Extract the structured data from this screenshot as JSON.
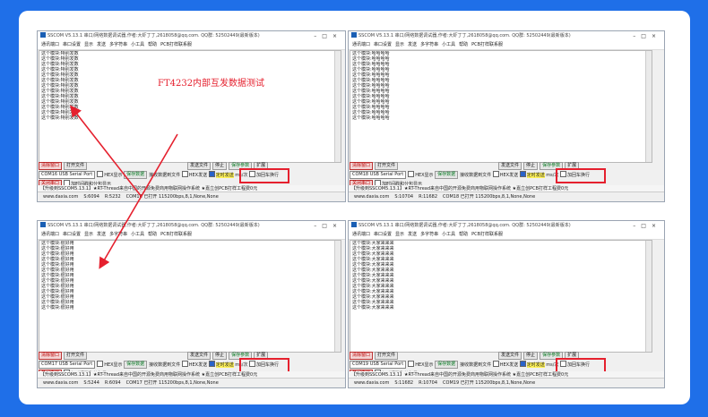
{
  "annotation": "FT4232内部互发数据测试",
  "windows": [
    {
      "id": "tl",
      "title": "SSCOM V5.13.1 串口/网络数据调试器,作者:大虾丁丁,2618058@qq.com. QQ群: 52502449(最新版本)",
      "menu": [
        "通讯端口",
        "串口设置",
        "显示",
        "发送",
        "多字符串",
        "小工具",
        "帮助",
        "PCB打样联系服"
      ],
      "recv_line": "这个模块:特别发数",
      "recv_count": 13,
      "port": "COM16 USB Serial Port",
      "open_btn": "关闭串口",
      "baud_label": "波特率",
      "baud": "115200",
      "send_text": "这个模块: 很好用",
      "timer_label": "定时发送",
      "send_btn": "发 送",
      "promo": "【升级到SSCOM5.13.1】★RT-Thread来自中国的开源免费商用物联网操作系统 ★嘉立创PCB打样工程费0元",
      "status": [
        "www.daxia.com",
        "S:6094",
        "R:5232",
        "COM16 已打开 115200bps,8,1,None,None"
      ]
    },
    {
      "id": "tr",
      "title": "SSCOM V5.13.1 串口/网络数据调试器,作者:大虾丁丁,2618058@qq.com. QQ群: 52502449(最新版本)",
      "menu": [
        "通讯端口",
        "串口设置",
        "显示",
        "发送",
        "多字符串",
        "小工具",
        "帮助",
        "PCB打样联系服"
      ],
      "recv_line": "这个模块:哈哈哈哈",
      "recv_count": 13,
      "port": "COM18 USB Serial Port",
      "open_btn": "关闭串口",
      "baud_label": "波特率",
      "baud": "115200",
      "send_text": "这个模块: 大家来来来",
      "timer_label": "定时发送",
      "send_btn": "发 送",
      "promo": "【升级到SSCOM5.13.1】★RT-Thread来自中国的开源免费商用物联网操作系统 ★嘉立创PCB打样工程费0元",
      "status": [
        "www.daxia.com",
        "S:10704",
        "R:11682",
        "COM18 已打开 115200bps,8,1,None,None"
      ]
    },
    {
      "id": "bl",
      "title": "SSCOM V5.13.1 串口/网络数据调试器,作者:大虾丁丁,2618058@qq.com. QQ群: 52502449(最新版本)",
      "menu": [
        "通讯端口",
        "串口设置",
        "显示",
        "发送",
        "多字符串",
        "小工具",
        "帮助",
        "PCB打样联系服"
      ],
      "recv_line": "这个模块:很好用",
      "recv_count": 13,
      "port": "COM17 USB Serial Port",
      "open_btn": "关闭串口",
      "baud_label": "波特率",
      "baud": "115200",
      "send_text": "这个模块: 特别发数",
      "timer_label": "定时发送",
      "send_btn": "发 送",
      "promo": "【升级到SSCOM5.13.1】★RT-Thread来自中国的开源免费商用物联网操作系统 ★嘉立创PCB打样工程费0元",
      "status": [
        "www.daxia.com",
        "S:5244",
        "R:6094",
        "COM17 已打开 115200bps,8,1,None,None"
      ]
    },
    {
      "id": "br",
      "title": "SSCOM V5.13.1 串口/网络数据调试器,作者:大虾丁丁,2618058@qq.com. QQ群: 52502449(最新版本)",
      "menu": [
        "通讯端口",
        "串口设置",
        "显示",
        "发送",
        "多字符串",
        "小工具",
        "帮助",
        "PCB打样联系服"
      ],
      "recv_line": "这个模块:大家来来来",
      "recv_count": 13,
      "port": "COM19 USB Serial Port",
      "open_btn": "关闭串口",
      "baud_label": "波特率",
      "baud": "115200",
      "send_text": "这个模块: 哈哈哈哈",
      "timer_label": "定时发送",
      "send_btn": "发 送",
      "promo": "【升级到SSCOM5.13.1】★RT-Thread来自中国的开源免费商用物联网操作系统 ★嘉立创PCB打样工程费0元",
      "status": [
        "www.daxia.com",
        "S:11682",
        "R:10704",
        "COM19 已打开 115200bps,8,1,None,None"
      ]
    }
  ],
  "labels": {
    "clear": "清除窗口",
    "open_file": "打开文件",
    "send_file": "发送文件",
    "stop": "停止",
    "save": "保存参数",
    "expand": "扩展",
    "hex_show": "HEX显示",
    "save_data": "保存数据",
    "recv_to_file": "接收数据到文件",
    "hex_send": "HEX发送",
    "add_ts": "加时间戳和分包显示",
    "more_ports": "更多串口设置",
    "ms": "ms/次",
    "add_enter": "加回车换行",
    "rts": "RTS",
    "dtr": "DTR"
  },
  "colors": {
    "page_bg": "#1f6fe8",
    "highlight": "#e5202e",
    "timer_bg": "#fff25a"
  }
}
